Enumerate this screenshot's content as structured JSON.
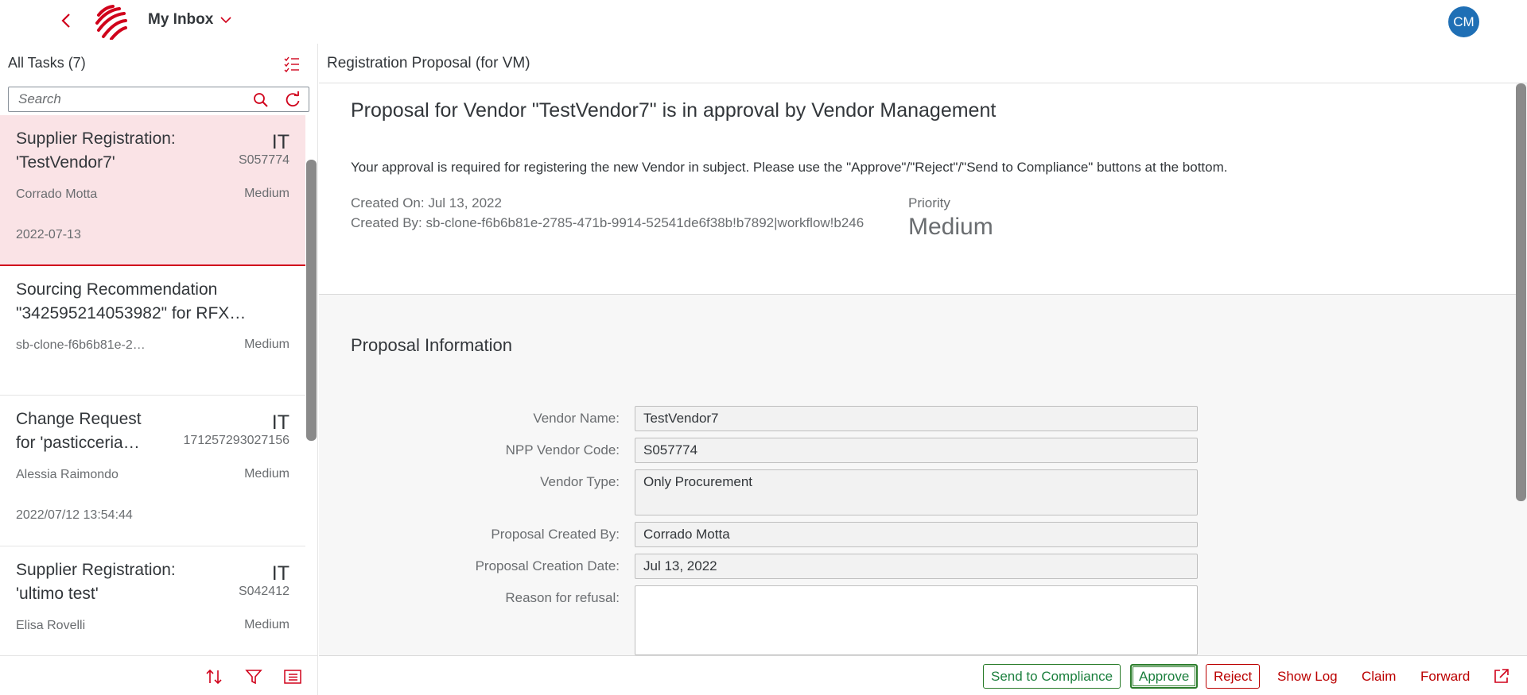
{
  "shell": {
    "title": "My Inbox",
    "avatar_initials": "CM"
  },
  "master": {
    "title": "All Tasks (7)",
    "search_placeholder": "Search",
    "items": [
      {
        "title_line1": "Supplier Registration:",
        "title_line2": "'TestVendor7'",
        "number": "IT",
        "unit": "S057774",
        "attribute": "Corrado Motta",
        "priority": "Medium",
        "date": "2022-07-13"
      },
      {
        "title_line1": "Sourcing Recommendation",
        "title_line2": "\"342595214053982\" for RFX…",
        "attribute": "sb-clone-f6b6b81e-2…",
        "priority": "Medium"
      },
      {
        "title_line1": "Change Request",
        "title_line2": "for 'pasticceria…",
        "number": "IT",
        "unit": "171257293027156",
        "attribute": "Alessia Raimondo",
        "priority": "Medium",
        "date": "2022/07/12 13:54:44"
      },
      {
        "title_line1": "Supplier Registration:",
        "title_line2": "'ultimo test'",
        "number": "IT",
        "unit": "S042412",
        "attribute": "Elisa Rovelli",
        "priority": "Medium"
      }
    ]
  },
  "detail": {
    "header_title": "Registration Proposal (for VM)",
    "heading": "Proposal for Vendor \"TestVendor7\" is in approval by Vendor Management",
    "description": "Your approval is required for registering the new Vendor in subject. Please use the \"Approve\"/\"Reject\"/\"Send to Compliance\" buttons at the bottom.",
    "created_on": "Created On: Jul 13, 2022",
    "created_by": "Created By: sb-clone-f6b6b81e-2785-471b-9914-52541de6f38b!b7892|workflow!b246",
    "priority_label": "Priority",
    "priority_value": "Medium",
    "section_title": "Proposal Information",
    "form": {
      "vendor_name_label": "Vendor Name:",
      "vendor_name": "TestVendor7",
      "npp_code_label": "NPP Vendor Code:",
      "npp_code": "S057774",
      "vendor_type_label": "Vendor Type:",
      "vendor_type": "Only Procurement",
      "created_by_label": "Proposal Created By:",
      "created_by": "Corrado Motta",
      "creation_date_label": "Proposal Creation Date:",
      "creation_date": "Jul 13, 2022",
      "reason_label": "Reason for refusal:",
      "reason": ""
    }
  },
  "footer": {
    "send_to_compliance": "Send to Compliance",
    "approve": "Approve",
    "reject": "Reject",
    "show_log": "Show Log",
    "claim": "Claim",
    "forward": "Forward"
  },
  "colors": {
    "brand_red": "#d0021b",
    "approve_green": "#2b7d2b",
    "avatar_blue": "#1f6fb5",
    "selected_bg": "#fae3e6"
  }
}
